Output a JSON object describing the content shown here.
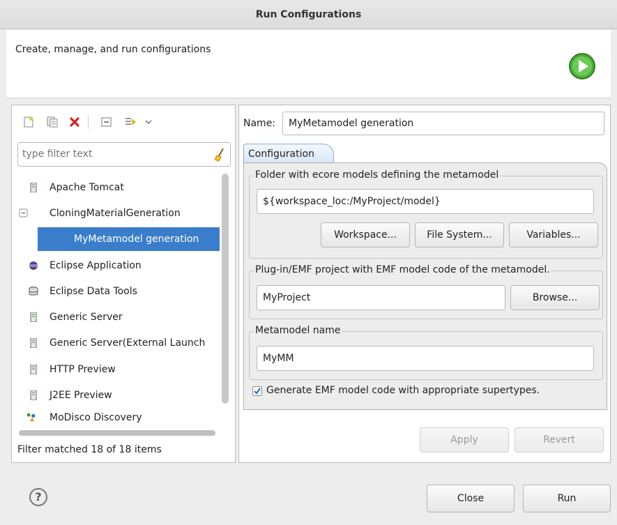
{
  "window": {
    "title": "Run Configurations"
  },
  "header": {
    "description": "Create, manage, and run configurations"
  },
  "toolbar": {
    "icons": [
      "new-configuration-icon",
      "duplicate-icon",
      "delete-icon",
      "collapse-all-icon",
      "filter-icon",
      "chevron-down-icon"
    ]
  },
  "filter": {
    "placeholder": "type filter text",
    "value": ""
  },
  "tree": {
    "items": [
      {
        "label": "Apache Tomcat",
        "icon": "server-icon",
        "level": 0
      },
      {
        "label": "CloningMaterialGeneration",
        "icon": "collapse-icon",
        "level": 0
      },
      {
        "label": "MyMetamodel generation",
        "icon": "",
        "level": 1,
        "selected": true
      },
      {
        "label": "Eclipse Application",
        "icon": "eclipse-icon",
        "level": 0
      },
      {
        "label": "Eclipse Data Tools",
        "icon": "database-icon",
        "level": 0
      },
      {
        "label": "Generic Server",
        "icon": "server-icon",
        "level": 0
      },
      {
        "label": "Generic Server(External Launch",
        "icon": "server-icon",
        "level": 0
      },
      {
        "label": "HTTP Preview",
        "icon": "server-icon",
        "level": 0
      },
      {
        "label": "J2EE Preview",
        "icon": "server-icon",
        "level": 0
      },
      {
        "label": "MoDisco Discovery",
        "icon": "modisco-icon",
        "level": 0
      }
    ]
  },
  "status": {
    "text": "Filter matched 18 of 18 items"
  },
  "config": {
    "name_label": "Name:",
    "name_value": "MyMetamodel generation",
    "tab_label": "Configuration",
    "folder_group": {
      "title": "Folder with ecore models defining the metamodel",
      "value": "${workspace_loc:/MyProject/model}",
      "workspace_button": "Workspace...",
      "filesystem_button": "File System...",
      "variables_button": "Variables..."
    },
    "plugin_group": {
      "title": "Plug-in/EMF project with EMF model code of the metamodel.",
      "value": "MyProject",
      "browse_button": "Browse..."
    },
    "metamodel_group": {
      "title": "Metamodel name",
      "value": "MyMM"
    },
    "generate_checkbox": {
      "label": "Generate EMF model code with appropriate supertypes.",
      "checked": true
    },
    "apply_button": "Apply",
    "revert_button": "Revert"
  },
  "footer": {
    "help_symbol": "?",
    "close_button": "Close",
    "run_button": "Run"
  },
  "colors": {
    "selection": "#3a7dca",
    "run_icon": "#4cae3a",
    "delete": "#d42020"
  }
}
